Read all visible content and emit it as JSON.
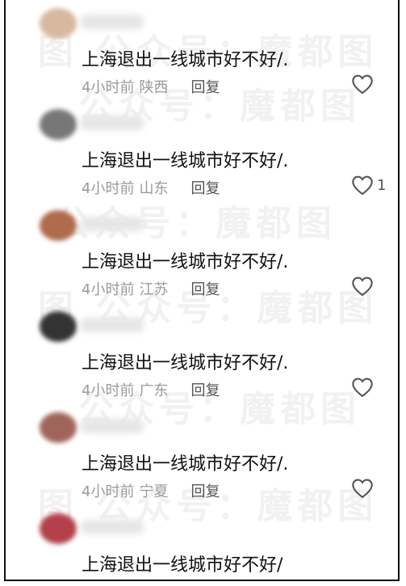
{
  "watermark": {
    "text1": "公众号：魔都图",
    "text2": "图  公众号：魔都图",
    "text3": "公众号：魔都图"
  },
  "comments": [
    {
      "text": "上海退出一线城市好不好/.",
      "time": "4小时前",
      "location": "陕西",
      "reply": "回复",
      "likes": "",
      "avatar_color": "#d9b8a0"
    },
    {
      "text": "上海退出一线城市好不好/.",
      "time": "4小时前",
      "location": "山东",
      "reply": "回复",
      "likes": "1",
      "avatar_color": "#777777"
    },
    {
      "text": "上海退出一线城市好不好/.",
      "time": "4小时前",
      "location": "江苏",
      "reply": "回复",
      "likes": "",
      "avatar_color": "#b06a4c"
    },
    {
      "text": "上海退出一线城市好不好/.",
      "time": "4小时前",
      "location": "广东",
      "reply": "回复",
      "likes": "",
      "avatar_color": "#333333"
    },
    {
      "text": "上海退出一线城市好不好/.",
      "time": "4小时前",
      "location": "宁夏",
      "reply": "回复",
      "likes": "",
      "avatar_color": "#a0655a"
    },
    {
      "text": "上海退出一线城市好不好/",
      "time": "",
      "location": "",
      "reply": "",
      "likes": "",
      "avatar_color": "#b3404a"
    }
  ],
  "icons": {
    "like": "heart-outline-icon"
  }
}
